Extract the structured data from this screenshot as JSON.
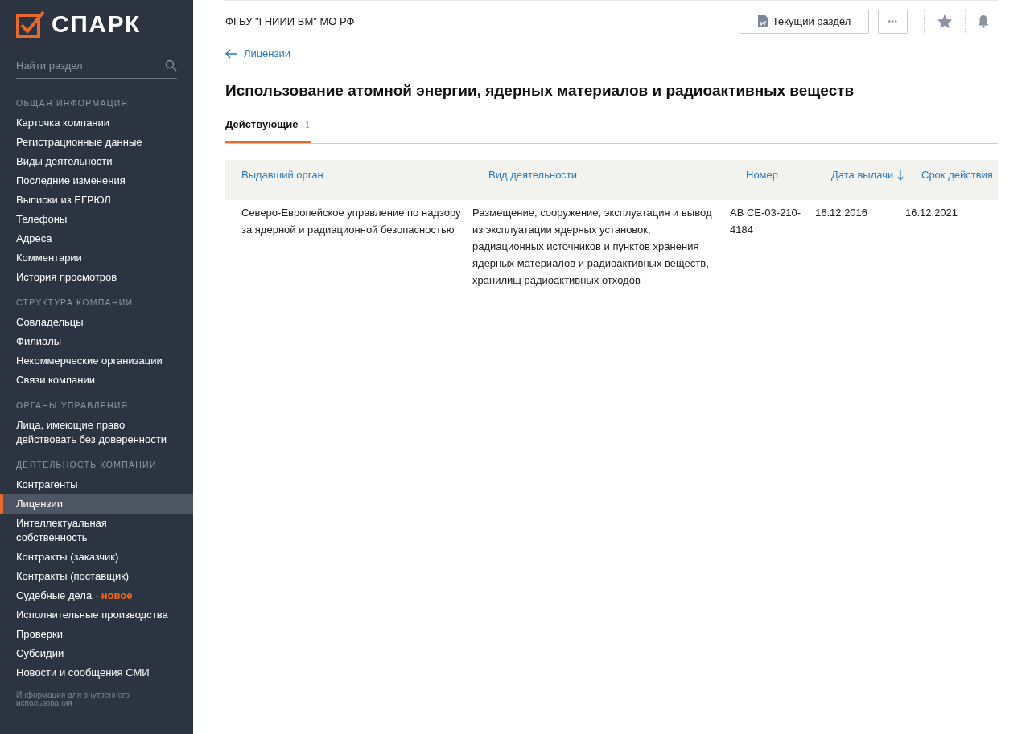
{
  "logo": {
    "text": "СПАРК"
  },
  "sidebar": {
    "search": {
      "placeholder": "Найти раздел"
    },
    "sections": [
      {
        "title": "ОБЩАЯ ИНФОРМАЦИЯ",
        "items": [
          {
            "label": "Карточка компании",
            "selected": false
          },
          {
            "label": "Регистрационные данные",
            "selected": false
          },
          {
            "label": "Виды деятельности",
            "selected": false
          },
          {
            "label": "Последние изменения",
            "selected": false
          },
          {
            "label": "Выписки из ЕГРЮЛ",
            "selected": false
          },
          {
            "label": "Телефоны",
            "selected": false
          },
          {
            "label": "Адреса",
            "selected": false
          },
          {
            "label": "Комментарии",
            "selected": false
          },
          {
            "label": "История просмотров",
            "selected": false
          }
        ]
      },
      {
        "title": "СТРУКТУРА КОМПАНИИ",
        "items": [
          {
            "label": "Совладельцы",
            "selected": false
          },
          {
            "label": "Филиалы",
            "selected": false
          },
          {
            "label": "Некоммерческие организации",
            "selected": false
          },
          {
            "label": "Связи компании",
            "selected": false
          }
        ]
      },
      {
        "title": "ОРГАНЫ УПРАВЛЕНИЯ",
        "items": [
          {
            "label": "Лица, имеющие право действовать без доверенности",
            "selected": false
          }
        ]
      },
      {
        "title": "ДЕЯТЕЛЬНОСТЬ КОМПАНИИ",
        "items": [
          {
            "label": "Контрагенты",
            "selected": false
          },
          {
            "label": "Лицензии",
            "selected": true
          },
          {
            "label": "Интеллектуальная собственность",
            "selected": false
          },
          {
            "label": "Контракты (заказчик)",
            "selected": false
          },
          {
            "label": "Контракты (поставщик)",
            "selected": false
          },
          {
            "label": "Судебные дела",
            "selected": false,
            "separator": "·",
            "badge": "новое"
          },
          {
            "label": "Исполнительные производства",
            "selected": false
          },
          {
            "label": "Проверки",
            "selected": false
          },
          {
            "label": "Субсидии",
            "selected": false
          },
          {
            "label": "Новости и сообщения СМИ",
            "selected": false
          }
        ]
      }
    ],
    "footer": "Информация для внутреннего использования"
  },
  "header": {
    "company": "ФГБУ \"ГНИИИ ВМ\" МО РФ",
    "current_section_button": "Текущий раздел",
    "more_button": "•••"
  },
  "back_link": "Лицензии",
  "title": "Использование атомной энергии, ядерных материалов и радиоактивных веществ",
  "tabs": [
    {
      "label": "Действующие",
      "separator": "·",
      "count": "1",
      "selected": true
    }
  ],
  "table": {
    "columns": [
      {
        "label": "Выдавший орган",
        "sorted": false
      },
      {
        "label": "Вид деятельности",
        "sorted": false
      },
      {
        "label": "Номер",
        "sorted": false
      },
      {
        "label": "Дата выдачи",
        "sorted": true
      },
      {
        "label": "Срок действия",
        "sorted": false
      }
    ],
    "rows": [
      [
        "Северо-Европейское управление по надзору за ядерной и радиационной безопасностью",
        "Размещение, сооружение, эксплуатация и вывод из эксплуатации ядерных установок, радиационных источников и пунктов хранения ядерных материалов и радиоактивных веществ, хранилищ радиоактивных отходов",
        "АВ СЕ-03-210-4184",
        "16.12.2016",
        "16.12.2021"
      ]
    ]
  }
}
